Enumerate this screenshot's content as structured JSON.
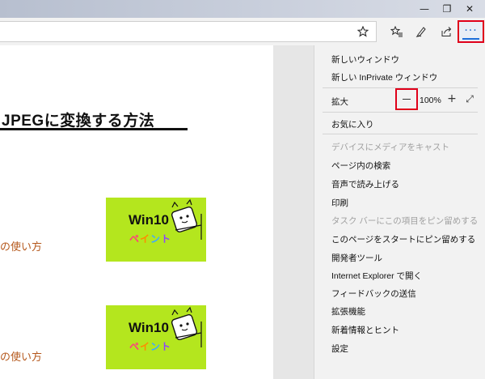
{
  "window": {
    "minimize_glyph": "—",
    "maximize_glyph": "❐",
    "close_glyph": "✕"
  },
  "toolbar": {
    "favorite_icon": "star-outline",
    "favorites_hub_icon": "star-list",
    "web_note_icon": "pen",
    "share_icon": "share",
    "more_label": "···"
  },
  "page": {
    "heading": "JPEGに変換する方法",
    "articles": [
      {
        "link_text": "の使い方",
        "thumb_title": "Win10",
        "thumb_subtitle": "ペイント"
      },
      {
        "link_text": "の使い方",
        "thumb_title": "Win10",
        "thumb_subtitle": "ペイント"
      }
    ],
    "thumb_subtitle_colors": [
      "#ff3d7f",
      "#ff8a00",
      "#3fa9ff",
      "#8e44ff"
    ]
  },
  "menu": {
    "new_window": "新しいウィンドウ",
    "new_inprivate": "新しい InPrivate ウィンドウ",
    "zoom_label": "拡大",
    "zoom_value": "100%",
    "zoom_plus": "+",
    "zoom_fullscreen": "⤢",
    "favorites": "お気に入り",
    "cast": "デバイスにメディアをキャスト",
    "find": "ページ内の検索",
    "read_aloud": "音声で読み上げる",
    "print": "印刷",
    "pin_taskbar": "タスク バーにこの項目をピン留めする",
    "pin_start": "このページをスタートにピン留めする",
    "dev_tools": "開発者ツール",
    "open_ie": "Internet Explorer で開く",
    "feedback": "フィードバックの送信",
    "extensions": "拡張機能",
    "whats_new": "新着情報とヒント",
    "settings": "設定"
  },
  "colors": {
    "highlight_box": "#e0001a",
    "accent": "#1e6fd9",
    "thumb_bg": "#b4e61e",
    "link": "#b5581c"
  }
}
